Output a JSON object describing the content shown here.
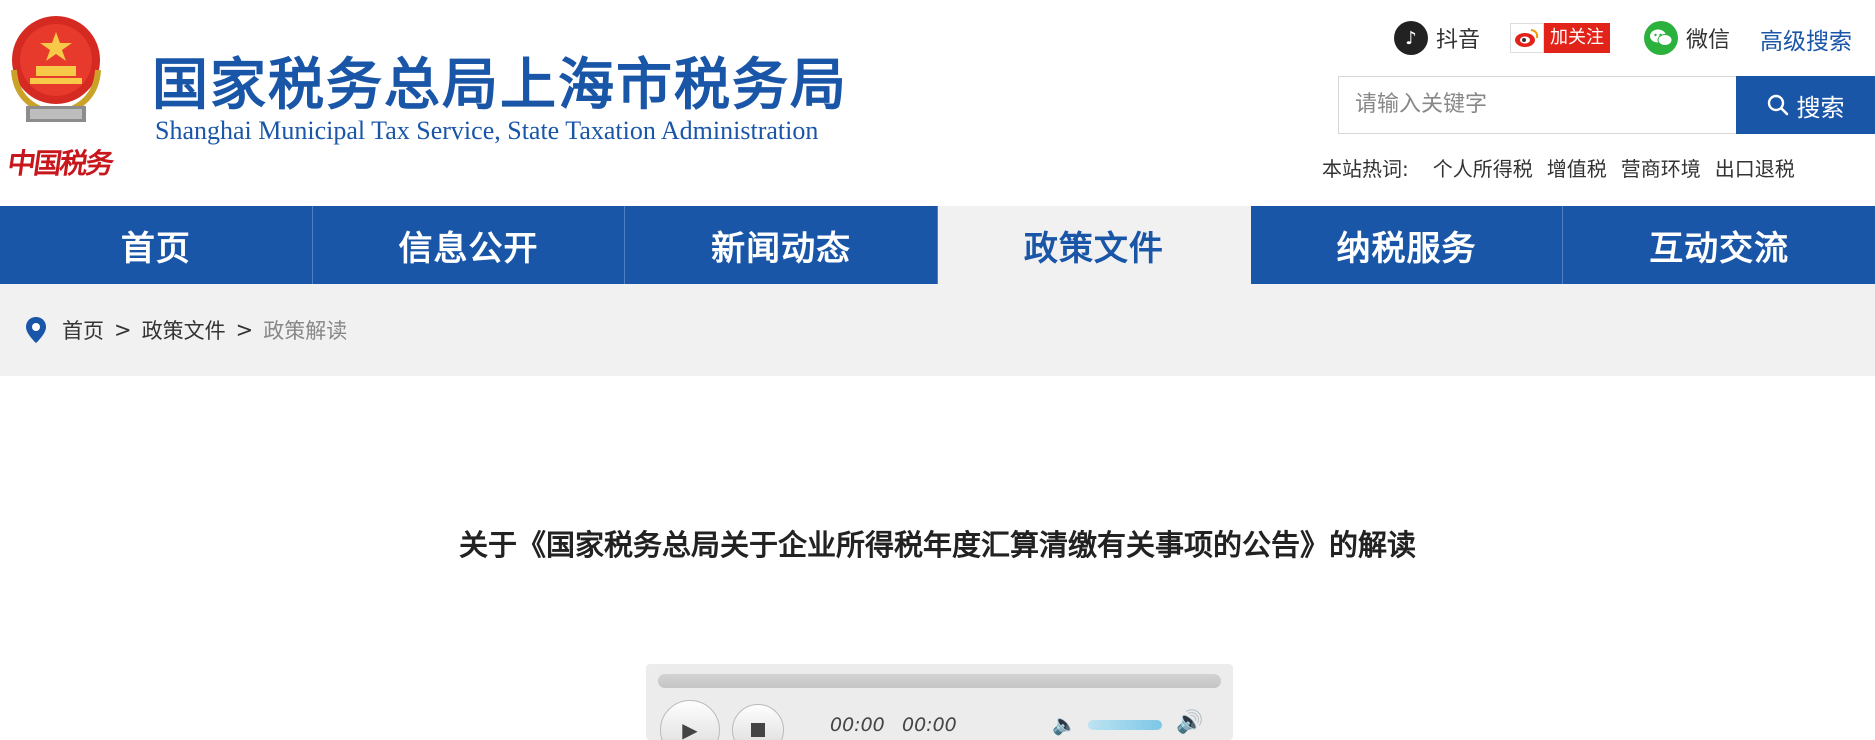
{
  "header": {
    "emblem_text": "中国税务",
    "title": "国家税务总局上海市税务局",
    "subtitle": "Shanghai Municipal Tax Service, State Taxation Administration",
    "social": {
      "douyin": "抖音",
      "weibo_follow": "加关注",
      "wechat": "微信"
    },
    "advanced_search": "高级搜索",
    "search": {
      "placeholder": "请输入关键字",
      "button": "搜索"
    },
    "hot": {
      "label": "本站热词:",
      "items": [
        "个人所得税",
        "增值税",
        "营商环境",
        "出口退税"
      ]
    }
  },
  "nav": {
    "items": [
      "首页",
      "信息公开",
      "新闻动态",
      "政策文件",
      "纳税服务",
      "互动交流"
    ],
    "active_index": 3
  },
  "breadcrumb": {
    "items": [
      "首页",
      "政策文件",
      "政策解读"
    ],
    "separator": ">"
  },
  "article": {
    "title": "关于《国家税务总局关于企业所得税年度汇算清缴有关事项的公告》的解读"
  },
  "player": {
    "current_time": "00:00",
    "duration": "00:00"
  },
  "colors": {
    "brand_blue": "#1a56a8",
    "accent_red": "#c8161d",
    "wechat_green": "#2bb23c"
  }
}
